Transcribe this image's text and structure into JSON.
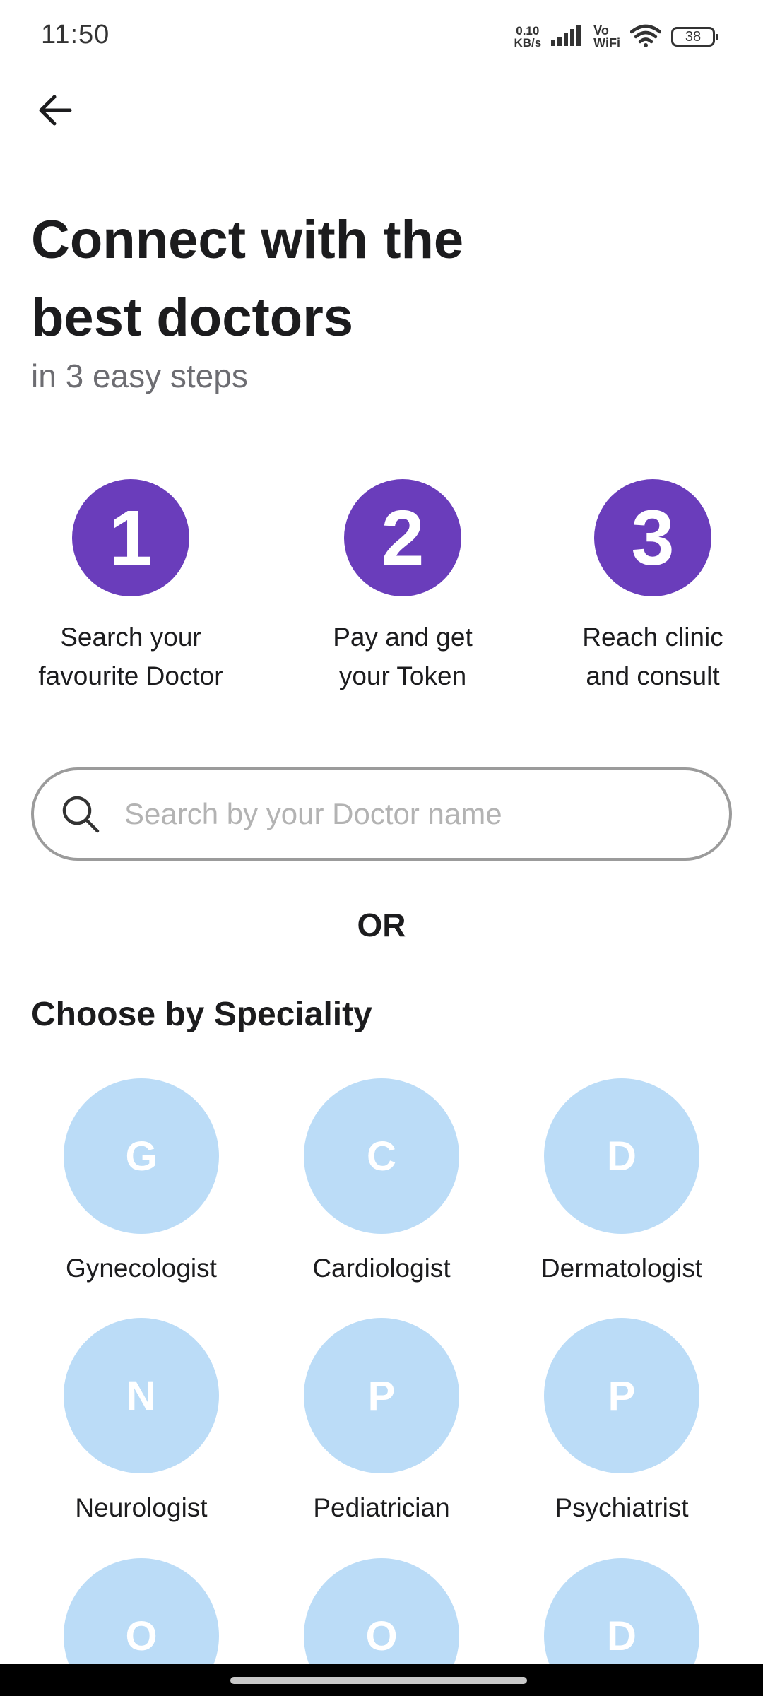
{
  "status_bar": {
    "time": "11:50",
    "net_speed_value": "0.10",
    "net_speed_unit": "KB/s",
    "vowifi_top": "Vo",
    "vowifi_bottom": "WiFi",
    "battery": "38",
    "icons": [
      "signal-icon",
      "wifi-icon",
      "battery-icon"
    ]
  },
  "header": {
    "back_icon": "arrow-left-icon"
  },
  "hero": {
    "title_line1": "Connect with the",
    "title_line2": "best doctors",
    "subtitle": "in 3 easy steps"
  },
  "steps": [
    {
      "number": "1",
      "line1": "Search your",
      "line2": "favourite Doctor"
    },
    {
      "number": "2",
      "line1": "Pay and get",
      "line2": "your Token"
    },
    {
      "number": "3",
      "line1": "Reach clinic",
      "line2": "and consult"
    }
  ],
  "search": {
    "placeholder": "Search by your Doctor name",
    "value": "",
    "icon": "search-icon"
  },
  "or_label": "OR",
  "specialities_section": {
    "title": "Choose by Speciality",
    "items": [
      {
        "initial": "G",
        "label": "Gynecologist"
      },
      {
        "initial": "C",
        "label": "Cardiologist"
      },
      {
        "initial": "D",
        "label": "Dermatologist"
      },
      {
        "initial": "N",
        "label": "Neurologist"
      },
      {
        "initial": "P",
        "label": "Pediatrician"
      },
      {
        "initial": "P",
        "label": "Psychiatrist"
      },
      {
        "initial": "O",
        "label": ""
      },
      {
        "initial": "O",
        "label": ""
      },
      {
        "initial": "D",
        "label": ""
      }
    ]
  },
  "colors": {
    "step_circle": "#6a3dbb",
    "speciality_circle": "#bbdcf7",
    "title_text": "#1c1c1e",
    "subtitle_text": "#6d6d72"
  }
}
